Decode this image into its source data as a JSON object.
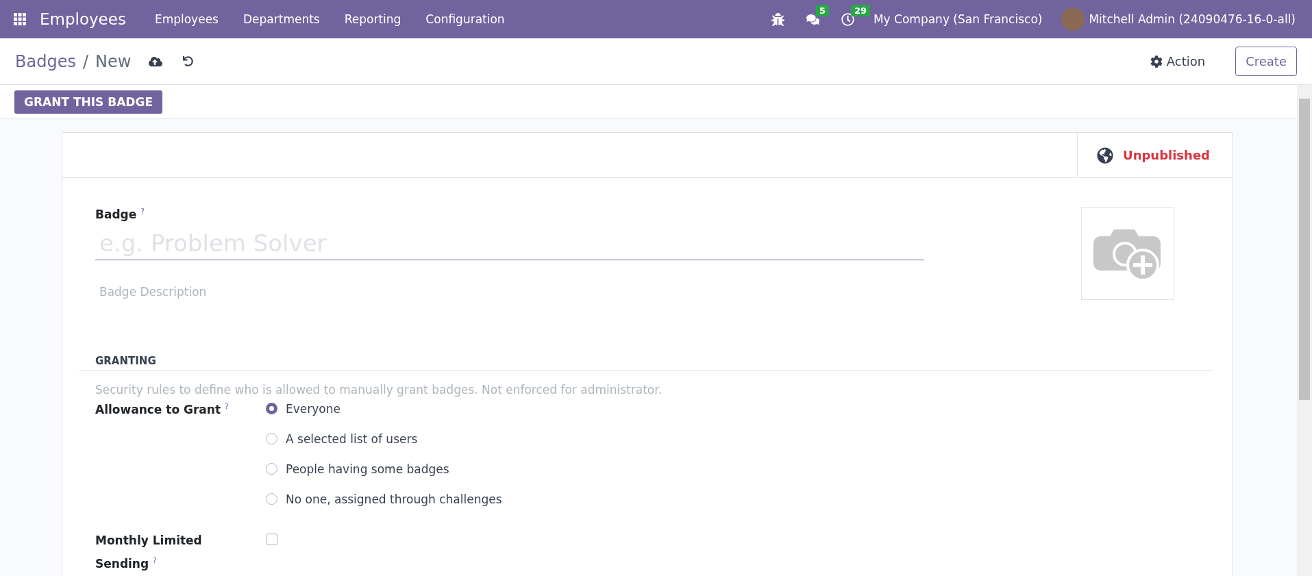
{
  "app": {
    "name": "Employees"
  },
  "menu": [
    "Employees",
    "Departments",
    "Reporting",
    "Configuration"
  ],
  "systray": {
    "messages_count": "5",
    "activities_count": "29",
    "company": "My Company (San Francisco)",
    "user": "Mitchell Admin (24090476-16-0-all)"
  },
  "breadcrumb": {
    "parent": "Badges",
    "separator": "/",
    "current": "New"
  },
  "actions": {
    "action": "Action",
    "create": "Create"
  },
  "grant_button": "GRANT THIS BADGE",
  "status": {
    "label": "Unpublished"
  },
  "form": {
    "name_label": "Badge $^{?}$",
    "name_placeholder": "e.g. Problem Solver",
    "description_placeholder": "Badge Description",
    "section": "GRANTING",
    "help": "Security rules to define who is allowed to manually grant badges. Not enforced for administrator.",
    "allowance_label": "Allowance to Grant $^{?}$",
    "options": [
      {
        "label": "Everyone",
        "selected": true
      },
      {
        "label": "A selected list of users",
        "selected": false
      },
      {
        "label": "People having some badges",
        "selected": false
      },
      {
        "label": "No one, assigned through challenges",
        "selected": false
      }
    ],
    "monthly": {
      "label": "Monthly Limited Sending $^{?}$",
      "checked": false
    }
  }
}
